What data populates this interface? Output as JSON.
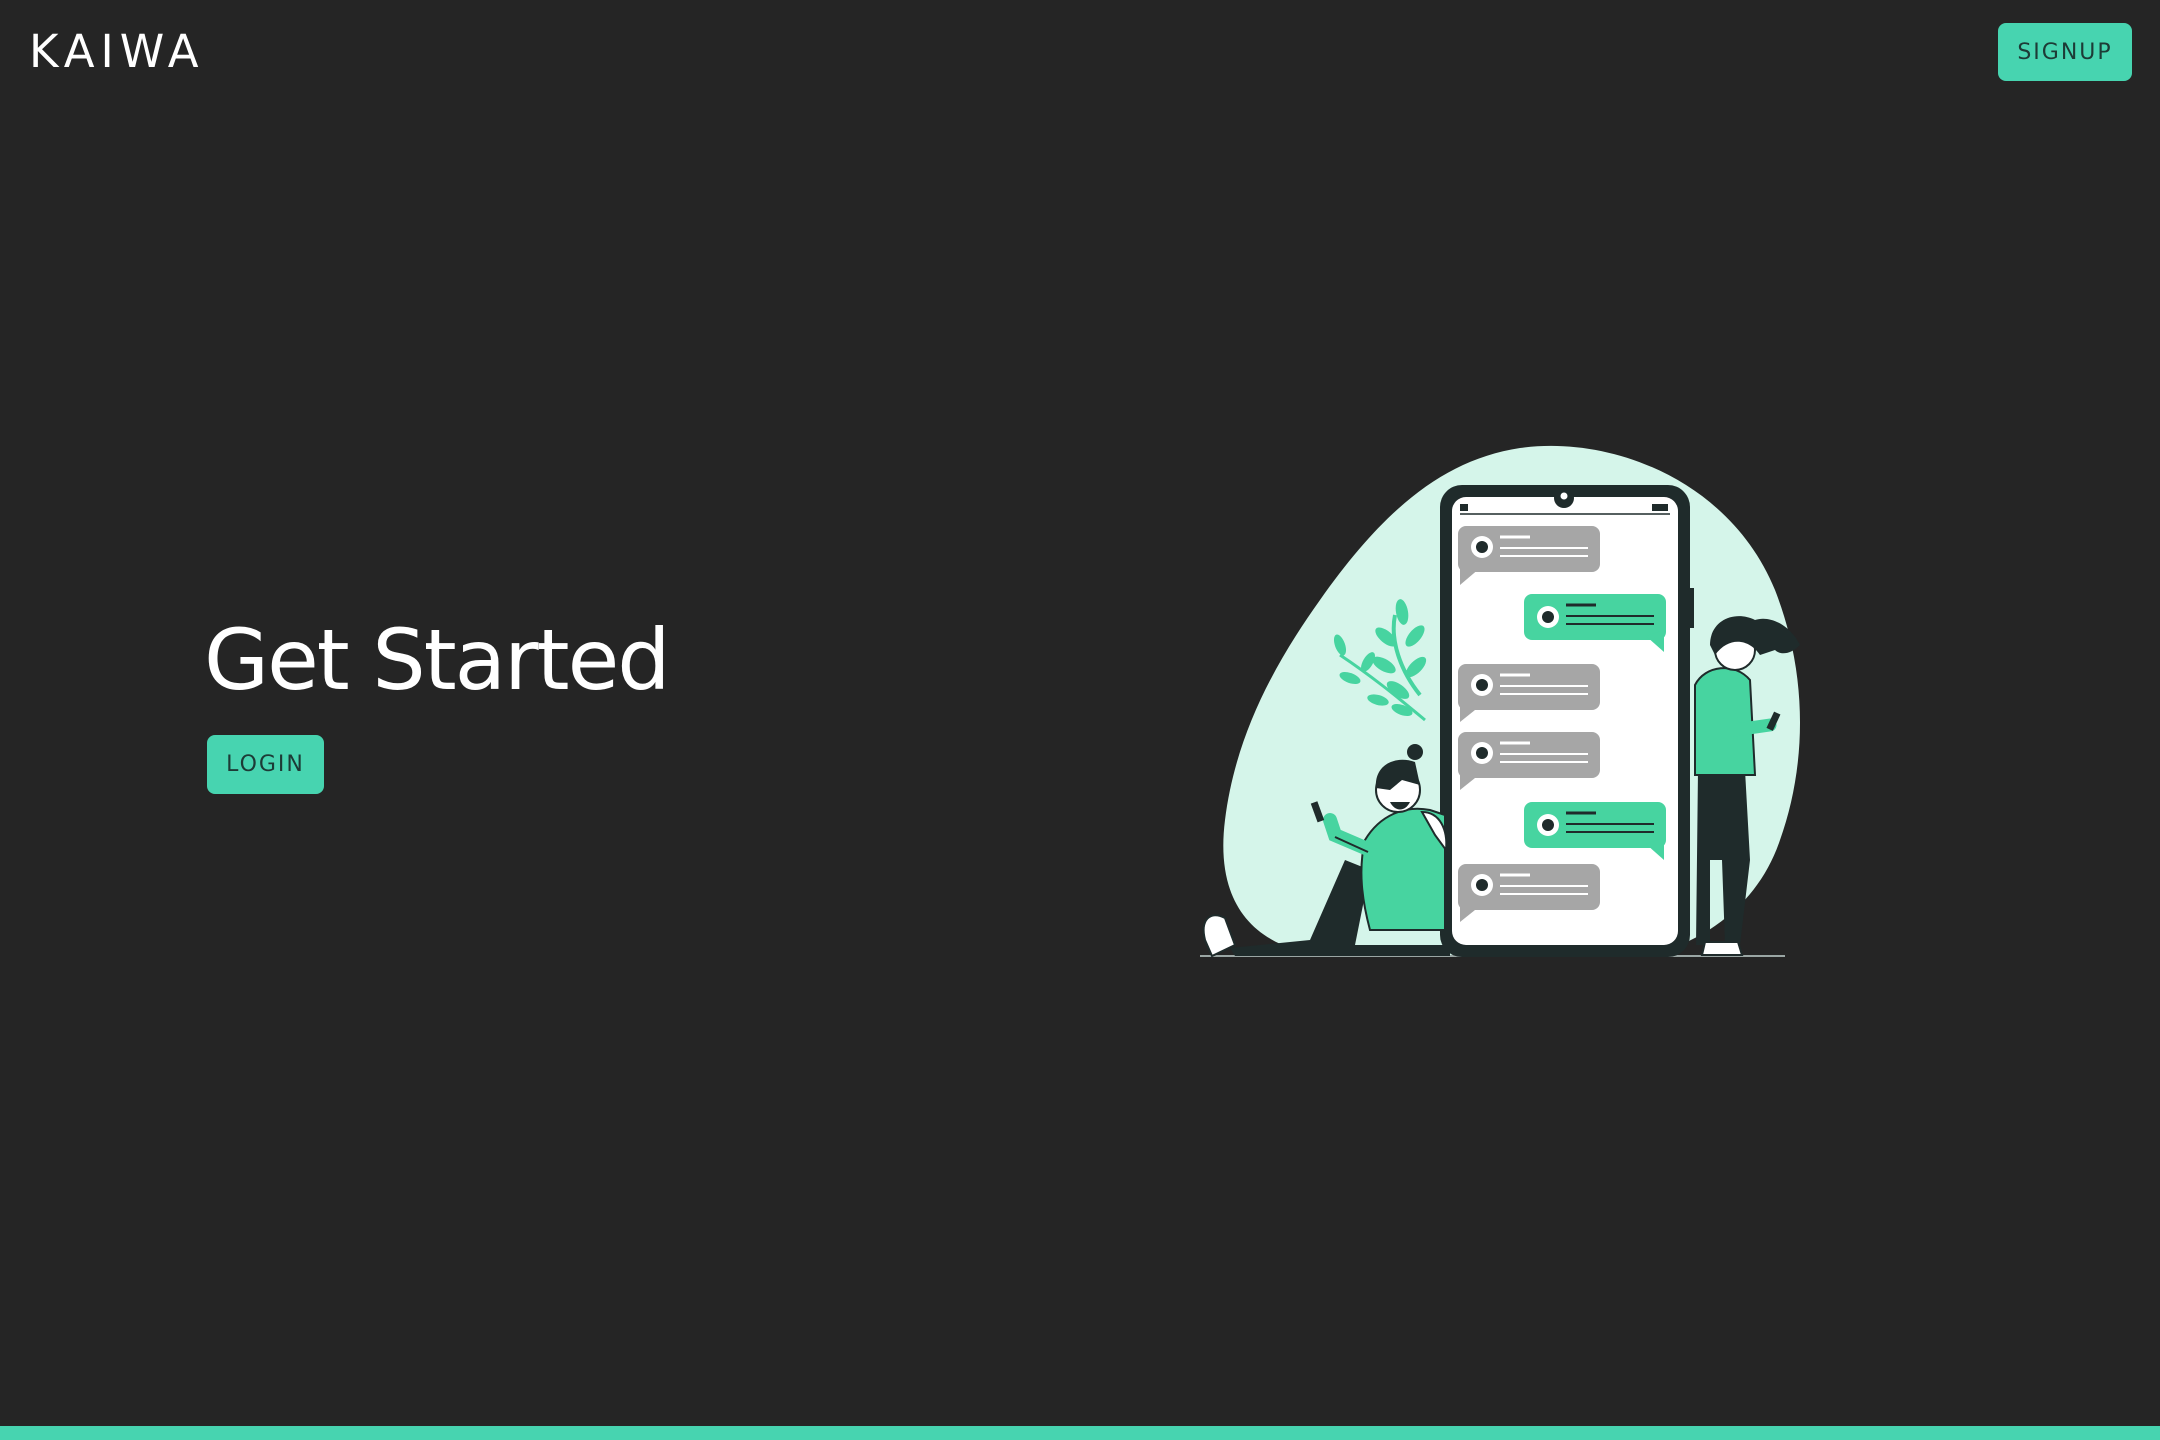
{
  "brand": {
    "logo": "KAIWA"
  },
  "header": {
    "signup_label": "SIGNUP"
  },
  "hero": {
    "title": "Get Started",
    "login_label": "LOGIN"
  },
  "colors": {
    "background": "#252525",
    "accent": "#47d4b0",
    "button_text": "#1d3b36",
    "text": "#ffffff",
    "illustration_blob": "#d5f5ea",
    "bubble_green": "#47d4a0",
    "bubble_gray": "#a6a6a6",
    "figure_dark": "#1f2b2b"
  },
  "illustration": {
    "name": "chat-illustration"
  }
}
